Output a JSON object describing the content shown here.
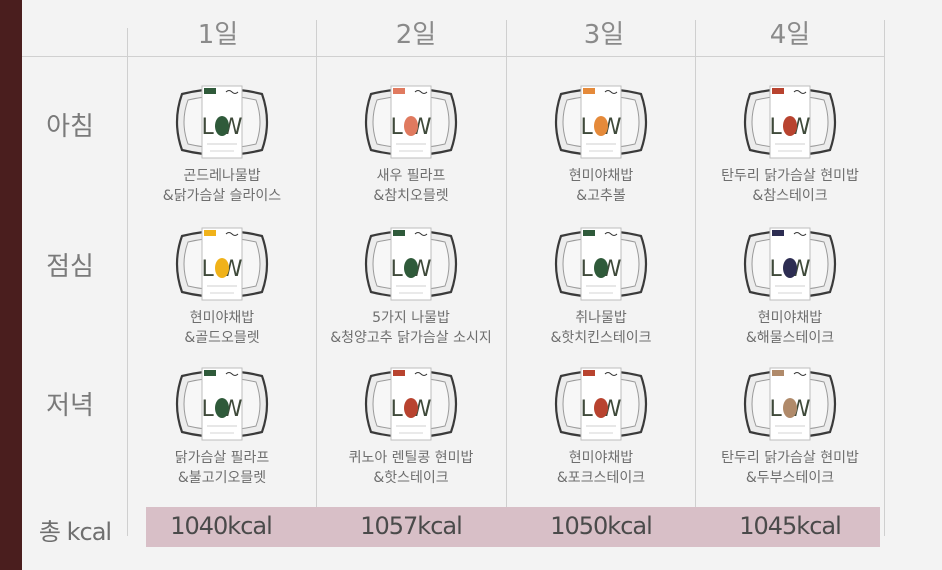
{
  "days": [
    "1일",
    "2일",
    "3일",
    "4일"
  ],
  "meals": [
    "아침",
    "점심",
    "저녁"
  ],
  "total_label": "총 kcal",
  "totals": [
    "1040kcal",
    "1057kcal",
    "1050kcal",
    "1045kcal"
  ],
  "colors": {
    "brand_dark": "#4a1e1e",
    "total_band": "#d8bfc7",
    "green_tab": "#2f5a3a",
    "orange_tab": "#e58a3a",
    "red_tab": "#b8432f",
    "yellow_tab": "#f0b21a",
    "navy_tab": "#2d2d52",
    "beige_tab": "#b08a6a",
    "salmon_tab": "#e07a5f"
  },
  "grid": [
    [
      {
        "line1": "곤드레나물밥",
        "line2": "&닭가슴살 슬라이스",
        "icon": "green-plant-icon",
        "accent": "#2f5a3a"
      },
      {
        "line1": "새우 필라프",
        "line2": "&참치오믈렛",
        "icon": "shrimp-icon",
        "accent": "#e07a5f"
      },
      {
        "line1": "현미야채밥",
        "line2": "&고추볼",
        "icon": "orange-monster-icon",
        "accent": "#e58a3a"
      },
      {
        "line1": "탄두리 닭가슴살 현미밥",
        "line2": "&참스테이크",
        "icon": "red-bear-icon",
        "accent": "#b8432f"
      }
    ],
    [
      {
        "line1": "현미야채밥",
        "line2": "&골드오믈렛",
        "icon": "yellow-egg-icon",
        "accent": "#f0b21a"
      },
      {
        "line1": "5가지 나물밥",
        "line2": "&청양고추 닭가슴살 소시지",
        "icon": "green-plant-icon",
        "accent": "#2f5a3a"
      },
      {
        "line1": "취나물밥",
        "line2": "&핫치킨스테이크",
        "icon": "green-plant-icon",
        "accent": "#2f5a3a"
      },
      {
        "line1": "현미야채밥",
        "line2": "&해물스테이크",
        "icon": "navy-squid-icon",
        "accent": "#2d2d52"
      }
    ],
    [
      {
        "line1": "닭가슴살 필라프",
        "line2": "&불고기오믈렛",
        "icon": "green-plant-icon",
        "accent": "#2f5a3a"
      },
      {
        "line1": "퀴노아 렌틸콩 현미밥",
        "line2": "&핫스테이크",
        "icon": "red-bear-icon",
        "accent": "#b8432f"
      },
      {
        "line1": "현미야채밥",
        "line2": "&포크스테이크",
        "icon": "red-bear-icon",
        "accent": "#b8432f"
      },
      {
        "line1": "탄두리 닭가슴살 현미밥",
        "line2": "&두부스테이크",
        "icon": "tofu-icon",
        "accent": "#b08a6a"
      }
    ]
  ]
}
